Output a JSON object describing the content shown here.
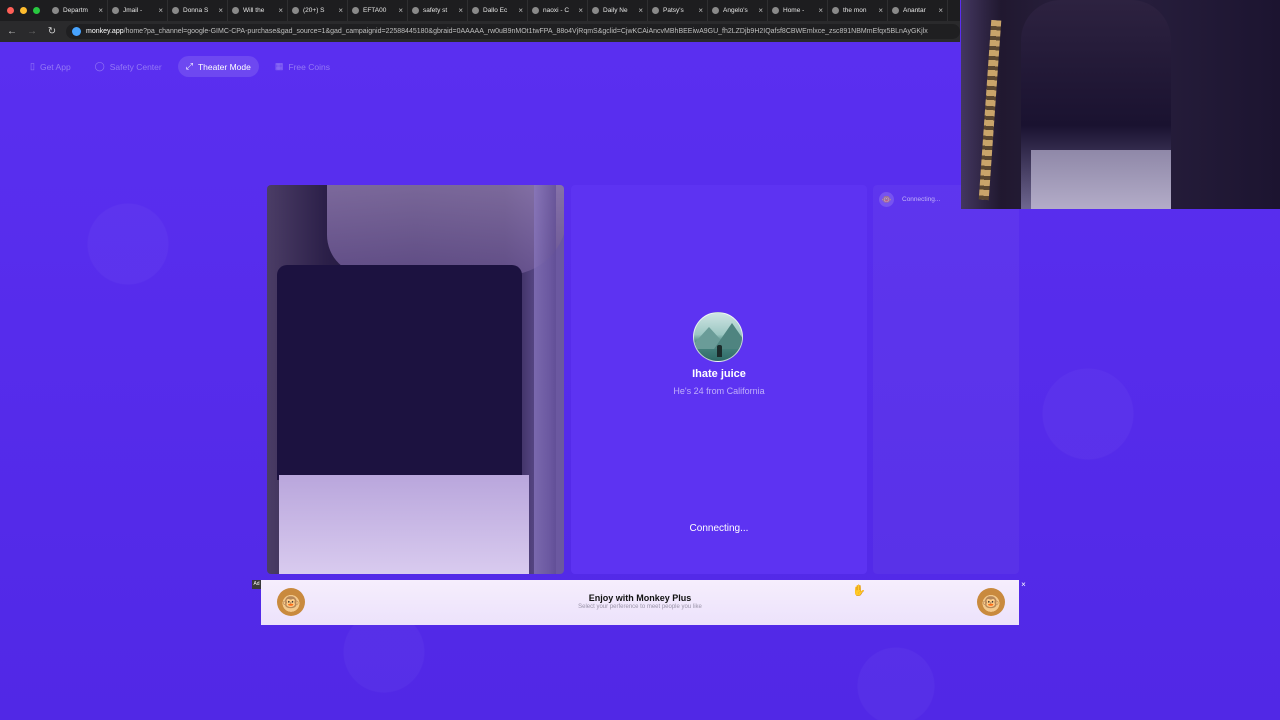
{
  "browser": {
    "tabs": [
      {
        "label": "Departm"
      },
      {
        "label": "Jmail -"
      },
      {
        "label": "Donna S"
      },
      {
        "label": "Will the"
      },
      {
        "label": "(20+) S"
      },
      {
        "label": "EFTA00"
      },
      {
        "label": "safety st"
      },
      {
        "label": "Dallo Ec"
      },
      {
        "label": "naoxi - C"
      },
      {
        "label": "Daily Ne"
      },
      {
        "label": "Patsy's"
      },
      {
        "label": "Angelo's"
      },
      {
        "label": "Home -"
      },
      {
        "label": "the mon"
      },
      {
        "label": "Anantar"
      }
    ],
    "url_host": "monkey.app",
    "url_rest": "/home?pa_channel=google-GIMC-CPA-purchase&gad_source=1&gad_campaignid=22588445180&gbraid=0AAAAA_rw0uB9nMOt1twFPA_88o4VjRqmS&gclid=CjwKCAiAncvMBhBEEiwA9GU_fh2LZDjb9H2IQafsf8CBWEmlxce_zsc891NBMmEfqx5BLnAyGKjlx"
  },
  "topnav": {
    "get_app": "Get App",
    "safety_center": "Safety Center",
    "theater_mode": "Theater Mode",
    "free_coins": "Free Coins"
  },
  "partner": {
    "name": "Ihate juice",
    "subtitle": "He's 24 from California",
    "status": "Connecting..."
  },
  "chat": {
    "status": "Connecting..."
  },
  "ad": {
    "badge": "Ad",
    "title": "Enjoy with Monkey Plus",
    "subtitle": "Select your perference to meet people you like",
    "close": "×"
  },
  "colors": {
    "background": "#5b2ef0",
    "panel": "#5d33f2",
    "ad_bg": "#f3ebfd"
  }
}
